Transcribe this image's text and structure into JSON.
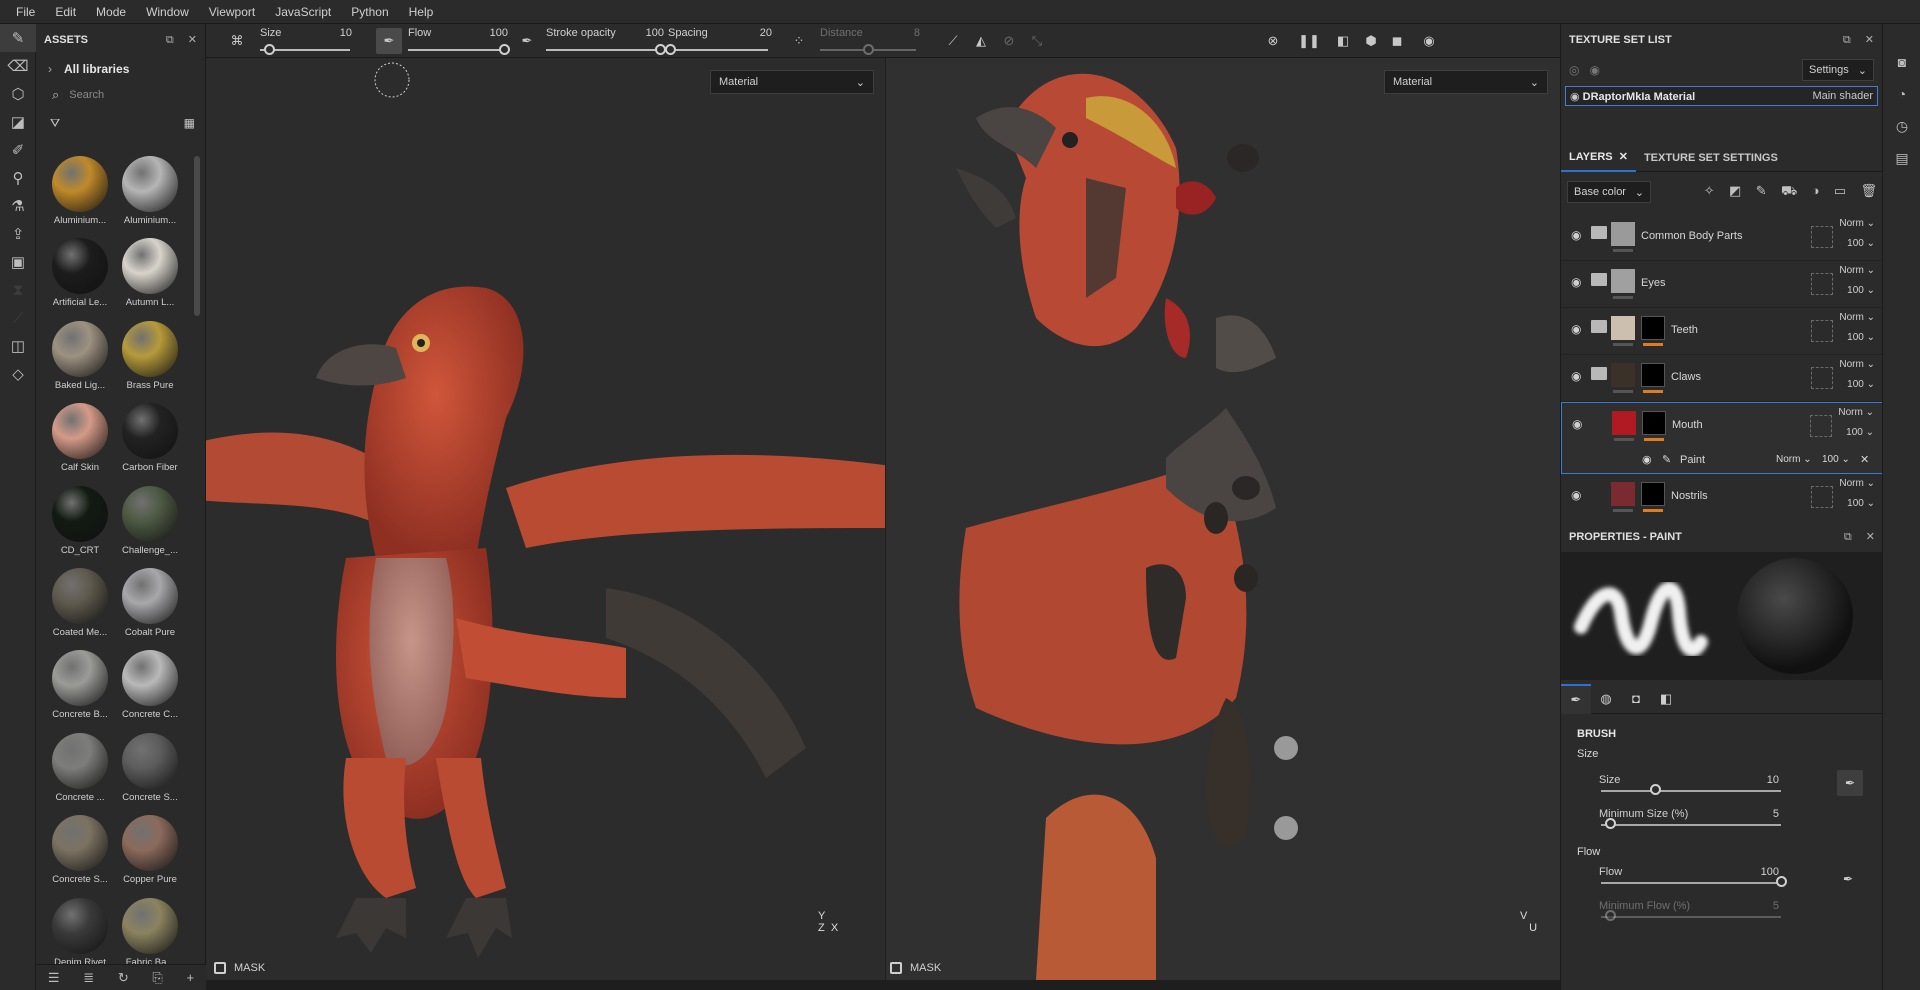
{
  "menu": [
    "File",
    "Edit",
    "Mode",
    "Window",
    "Viewport",
    "JavaScript",
    "Python",
    "Help"
  ],
  "assets": {
    "title": "ASSETS",
    "libraries": "All libraries",
    "search_placeholder": "Search",
    "materials": [
      {
        "label": "Aluminium...",
        "color": "#c08a2a"
      },
      {
        "label": "Aluminium...",
        "color": "#b5b5b5"
      },
      {
        "label": "Artificial Le...",
        "color": "#1c1c1c"
      },
      {
        "label": "Autumn L...",
        "color": "#d8d4cc"
      },
      {
        "label": "Baked Lig...",
        "color": "#9d9282"
      },
      {
        "label": "Brass Pure",
        "color": "#b69a3a"
      },
      {
        "label": "Calf Skin",
        "color": "#d59a88"
      },
      {
        "label": "Carbon Fiber",
        "color": "#222222"
      },
      {
        "label": "CD_CRT",
        "color": "#121a12"
      },
      {
        "label": "Challenge_...",
        "color": "#4e5a44"
      },
      {
        "label": "Coated Me...",
        "color": "#5f5a4e"
      },
      {
        "label": "Cobalt Pure",
        "color": "#a8a8ab"
      },
      {
        "label": "Concrete B...",
        "color": "#9b9b98"
      },
      {
        "label": "Concrete C...",
        "color": "#b9b9b9"
      },
      {
        "label": "Concrete ...",
        "color": "#7d7d7b"
      },
      {
        "label": "Concrete S...",
        "color": "#5d5d5d"
      },
      {
        "label": "Concrete S...",
        "color": "#7c7262"
      },
      {
        "label": "Copper Pure",
        "color": "#8c6a5c"
      },
      {
        "label": "Denim Rivet",
        "color": "#3a3a3a"
      },
      {
        "label": "Fabric Ba...",
        "color": "#8b8360"
      }
    ]
  },
  "toolbar": {
    "size_label": "Size",
    "size_value": "10",
    "size_fraction": 0.1,
    "flow_label": "Flow",
    "flow_value": "100",
    "flow_fraction": 1.0,
    "stroke_label": "Stroke opacity",
    "stroke_value": "100",
    "stroke_fraction": 1.0,
    "spacing_label": "Spacing",
    "spacing_value": "20",
    "spacing_fraction": 0.02,
    "distance_label": "Distance",
    "distance_value": "8",
    "distance_fraction": 0.5
  },
  "viewport3d": {
    "mode": "Material",
    "mask_label": "MASK"
  },
  "viewport2d": {
    "mode": "Material",
    "mask_label": "MASK"
  },
  "texture_set_list": {
    "title": "TEXTURE SET LIST",
    "settings_label": "Settings",
    "item_name": "DRaptorMkIa Material",
    "item_shader": "Main shader"
  },
  "layers_panel": {
    "tab_layers": "LAYERS",
    "tab_settings": "TEXTURE SET SETTINGS",
    "channel": "Base color",
    "layers": [
      {
        "name": "Common Body Parts",
        "blend": "Norm",
        "opacity": "100",
        "thumb": "#9a9a9a",
        "mask": "",
        "folder": true
      },
      {
        "name": "Eyes",
        "blend": "Norm",
        "opacity": "100",
        "thumb": "#a0a0a0",
        "mask": "",
        "folder": true
      },
      {
        "name": "Teeth",
        "blend": "Norm",
        "opacity": "100",
        "thumb": "#cdbfb0",
        "mask": "#000000",
        "folder": true
      },
      {
        "name": "Claws",
        "blend": "Norm",
        "opacity": "100",
        "thumb": "#3a3128",
        "mask": "#000000",
        "folder": true
      },
      {
        "name": "Mouth",
        "blend": "Norm",
        "opacity": "100",
        "thumb": "#b11a22",
        "mask": "#000000",
        "folder": false
      },
      {
        "name": "Nostrils",
        "blend": "Norm",
        "opacity": "100",
        "thumb": "#7a2a30",
        "mask": "#000000",
        "folder": false
      }
    ],
    "sublayer": {
      "name": "Paint",
      "blend": "Norm",
      "opacity": "100"
    }
  },
  "properties": {
    "title": "PROPERTIES - PAINT",
    "brush_section": "BRUSH",
    "size_group": "Size",
    "size_label": "Size",
    "size_value": "10",
    "size_fraction": 0.3,
    "min_size_label": "Minimum Size (%)",
    "min_size_value": "5",
    "min_size_fraction": 0.05,
    "flow_group": "Flow",
    "flow_label": "Flow",
    "flow_value": "100",
    "flow_fraction": 1.0,
    "min_flow_label": "Minimum Flow (%)",
    "min_flow_value": "5",
    "min_flow_fraction": 0.05
  }
}
